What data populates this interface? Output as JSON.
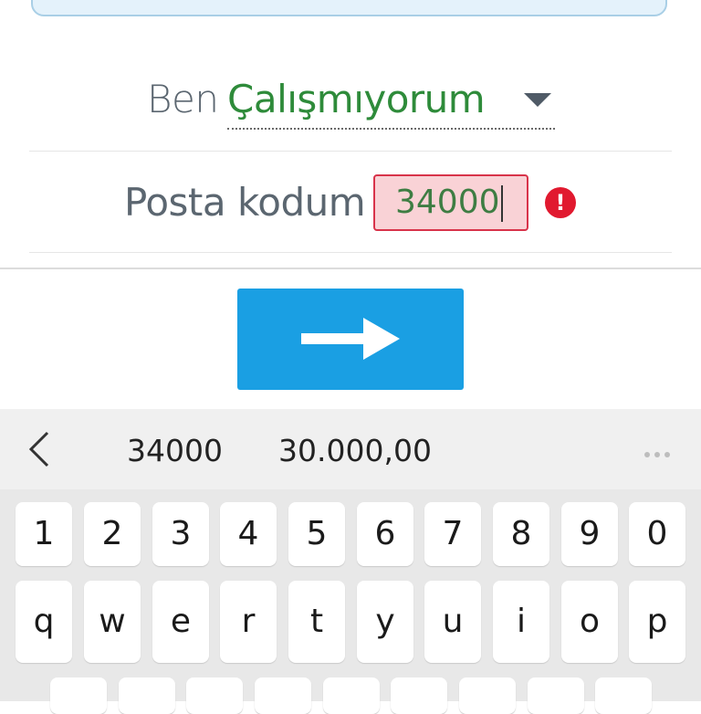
{
  "form": {
    "employment_prefix": "Ben",
    "employment_value": "Çalışmıyorum",
    "postal_label": "Posta kodum",
    "postal_value": "34000",
    "error_glyph": "!",
    "error_color": "#e1192f",
    "next_button_icon": "arrow-right-icon",
    "accent_color": "#1a9fe3"
  },
  "keyboard": {
    "suggestions": [
      "34000",
      "30.000,00"
    ],
    "number_row": [
      "1",
      "2",
      "3",
      "4",
      "5",
      "6",
      "7",
      "8",
      "9",
      "0"
    ],
    "letter_row": [
      "q",
      "w",
      "e",
      "r",
      "t",
      "y",
      "u",
      "i",
      "o",
      "p"
    ]
  }
}
